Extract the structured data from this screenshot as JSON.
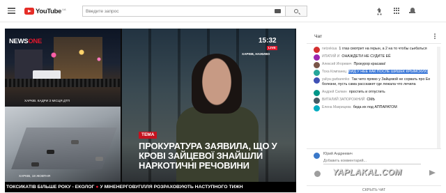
{
  "header": {
    "logo_text": "YouTube",
    "logo_region": "UA",
    "search_placeholder": "Введите запрос"
  },
  "video": {
    "channel_logo": {
      "part1": "NEWS",
      "part2": "ONE"
    },
    "tile1_caption": "ХАРКІВ. КАДРИ З МІСЦЯ ДТП",
    "tile2_caption": "ХАРКІВ, 18 ЖОВТНЯ",
    "clock": "15:32",
    "live_badge": "LIVE",
    "location_badge": "ХАРКІВ, НАЖИВО",
    "topic_badge": "ТЕМА",
    "headline": "ПРОКУРАТУРА ЗАЯВИЛА, ЩО У КРОВІ ЗАЙЦЕВОЇ ЗНАЙШЛИ НАРКОТИЧНІ РЕЧОВИНИ",
    "ticker": [
      "ТОКСИКАТІВ БІЛЬШЕ РОКУ - ЕКОЛОГ",
      "У МІНЕНЕРГОВУГІЛЛЯ РОЗРАХОВУЮТЬ НАСТУПНОГО ТИЖН"
    ]
  },
  "chat": {
    "title": "Чат",
    "messages": [
      {
        "author": "netzekiua",
        "text": "1 глаз смотрит на герын, а 2 на то чтобы сьебаться",
        "color": "#d32f2f"
      },
      {
        "author": "ИПАТИЙ И",
        "text": "ОНАЖДЕТИ НЕ СУДИТЕ ЕЁ",
        "color": "#9c27b0"
      },
      {
        "author": "Алексей Игоревич",
        "text": "Прокурор красава!",
        "color": "#795548"
      },
      {
        "author": "Тоха Компанец",
        "text": "ВИД У НЕЕ КАК ПОСЛЕ ШИШЕК КРЫМСКИХ)",
        "color": "#26a69a"
      },
      {
        "author": "yuliya garbarenko",
        "text": "Так чето прямо у Зайцевой не сорвать про Ее болезни, пусть сама расскажет где лежала что лечила",
        "color": "#3f51b5"
      },
      {
        "author": "Андрей Силкин",
        "text": "простить и отпустить",
        "color": "#009688"
      },
      {
        "author": "ВИТАЛИЙ ЗАПОРОЖНИЙ",
        "text": "СМЬ",
        "color": "#455a64"
      },
      {
        "author": "Елена Макрицева",
        "text": "беда их под АППАРАТОМ",
        "color": "#00acc1"
      }
    ],
    "compose": {
      "user_name": "Юрий Андреевич",
      "placeholder": "Добавить комментарий..."
    },
    "watermark": "YAPLAKAL.COM",
    "hide_label": "СКРЫТЬ ЧАТ"
  }
}
